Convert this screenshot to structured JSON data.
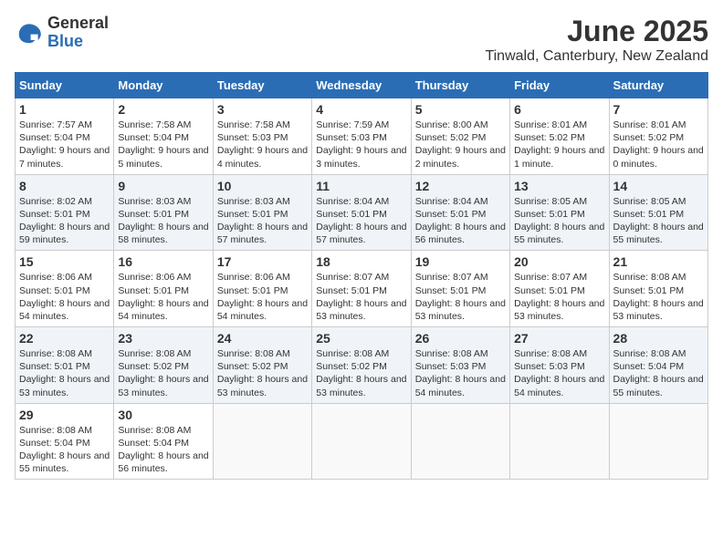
{
  "app": {
    "name_general": "General",
    "name_blue": "Blue"
  },
  "header": {
    "month": "June 2025",
    "location": "Tinwald, Canterbury, New Zealand"
  },
  "weekdays": [
    "Sunday",
    "Monday",
    "Tuesday",
    "Wednesday",
    "Thursday",
    "Friday",
    "Saturday"
  ],
  "weeks": [
    [
      {
        "day": "1",
        "sunrise": "7:57 AM",
        "sunset": "5:04 PM",
        "daylight": "9 hours and 7 minutes."
      },
      {
        "day": "2",
        "sunrise": "7:58 AM",
        "sunset": "5:04 PM",
        "daylight": "9 hours and 5 minutes."
      },
      {
        "day": "3",
        "sunrise": "7:58 AM",
        "sunset": "5:03 PM",
        "daylight": "9 hours and 4 minutes."
      },
      {
        "day": "4",
        "sunrise": "7:59 AM",
        "sunset": "5:03 PM",
        "daylight": "9 hours and 3 minutes."
      },
      {
        "day": "5",
        "sunrise": "8:00 AM",
        "sunset": "5:02 PM",
        "daylight": "9 hours and 2 minutes."
      },
      {
        "day": "6",
        "sunrise": "8:01 AM",
        "sunset": "5:02 PM",
        "daylight": "9 hours and 1 minute."
      },
      {
        "day": "7",
        "sunrise": "8:01 AM",
        "sunset": "5:02 PM",
        "daylight": "9 hours and 0 minutes."
      }
    ],
    [
      {
        "day": "8",
        "sunrise": "8:02 AM",
        "sunset": "5:01 PM",
        "daylight": "8 hours and 59 minutes."
      },
      {
        "day": "9",
        "sunrise": "8:03 AM",
        "sunset": "5:01 PM",
        "daylight": "8 hours and 58 minutes."
      },
      {
        "day": "10",
        "sunrise": "8:03 AM",
        "sunset": "5:01 PM",
        "daylight": "8 hours and 57 minutes."
      },
      {
        "day": "11",
        "sunrise": "8:04 AM",
        "sunset": "5:01 PM",
        "daylight": "8 hours and 57 minutes."
      },
      {
        "day": "12",
        "sunrise": "8:04 AM",
        "sunset": "5:01 PM",
        "daylight": "8 hours and 56 minutes."
      },
      {
        "day": "13",
        "sunrise": "8:05 AM",
        "sunset": "5:01 PM",
        "daylight": "8 hours and 55 minutes."
      },
      {
        "day": "14",
        "sunrise": "8:05 AM",
        "sunset": "5:01 PM",
        "daylight": "8 hours and 55 minutes."
      }
    ],
    [
      {
        "day": "15",
        "sunrise": "8:06 AM",
        "sunset": "5:01 PM",
        "daylight": "8 hours and 54 minutes."
      },
      {
        "day": "16",
        "sunrise": "8:06 AM",
        "sunset": "5:01 PM",
        "daylight": "8 hours and 54 minutes."
      },
      {
        "day": "17",
        "sunrise": "8:06 AM",
        "sunset": "5:01 PM",
        "daylight": "8 hours and 54 minutes."
      },
      {
        "day": "18",
        "sunrise": "8:07 AM",
        "sunset": "5:01 PM",
        "daylight": "8 hours and 53 minutes."
      },
      {
        "day": "19",
        "sunrise": "8:07 AM",
        "sunset": "5:01 PM",
        "daylight": "8 hours and 53 minutes."
      },
      {
        "day": "20",
        "sunrise": "8:07 AM",
        "sunset": "5:01 PM",
        "daylight": "8 hours and 53 minutes."
      },
      {
        "day": "21",
        "sunrise": "8:08 AM",
        "sunset": "5:01 PM",
        "daylight": "8 hours and 53 minutes."
      }
    ],
    [
      {
        "day": "22",
        "sunrise": "8:08 AM",
        "sunset": "5:01 PM",
        "daylight": "8 hours and 53 minutes."
      },
      {
        "day": "23",
        "sunrise": "8:08 AM",
        "sunset": "5:02 PM",
        "daylight": "8 hours and 53 minutes."
      },
      {
        "day": "24",
        "sunrise": "8:08 AM",
        "sunset": "5:02 PM",
        "daylight": "8 hours and 53 minutes."
      },
      {
        "day": "25",
        "sunrise": "8:08 AM",
        "sunset": "5:02 PM",
        "daylight": "8 hours and 53 minutes."
      },
      {
        "day": "26",
        "sunrise": "8:08 AM",
        "sunset": "5:03 PM",
        "daylight": "8 hours and 54 minutes."
      },
      {
        "day": "27",
        "sunrise": "8:08 AM",
        "sunset": "5:03 PM",
        "daylight": "8 hours and 54 minutes."
      },
      {
        "day": "28",
        "sunrise": "8:08 AM",
        "sunset": "5:04 PM",
        "daylight": "8 hours and 55 minutes."
      }
    ],
    [
      {
        "day": "29",
        "sunrise": "8:08 AM",
        "sunset": "5:04 PM",
        "daylight": "8 hours and 55 minutes."
      },
      {
        "day": "30",
        "sunrise": "8:08 AM",
        "sunset": "5:04 PM",
        "daylight": "8 hours and 56 minutes."
      },
      null,
      null,
      null,
      null,
      null
    ]
  ]
}
